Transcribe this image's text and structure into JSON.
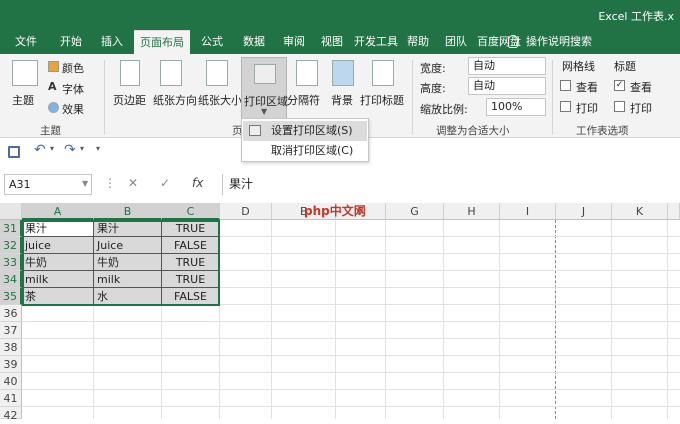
{
  "titlebar": {
    "title": "Excel 工作表.x"
  },
  "tabs": [
    "文件",
    "开始",
    "插入",
    "页面布局",
    "公式",
    "数据",
    "审阅",
    "视图",
    "开发工具",
    "帮助",
    "团队",
    "百度网盘"
  ],
  "active_tab": "页面布局",
  "tell_me": "操作说明搜索",
  "ribbon": {
    "themes": {
      "theme": "主题",
      "colors": "颜色",
      "fonts": "字体",
      "effects": "效果",
      "group": "主题"
    },
    "page_setup": {
      "margins": "页边距",
      "orientation": "纸张方向",
      "size": "纸张大小",
      "print_area": "打印区域",
      "breaks": "分隔符",
      "background": "背景",
      "print_titles": "打印标题",
      "group": "页"
    },
    "scale": {
      "width_label": "宽度:",
      "width_value": "自动",
      "height_label": "高度:",
      "height_value": "自动",
      "scale_label": "缩放比例:",
      "scale_value": "100%",
      "group": "调整为合适大小"
    },
    "sheet_options": {
      "gridlines": "网格线",
      "headings": "标题",
      "view1": "查看",
      "print1": "打印",
      "view2": "查看",
      "print2": "打印",
      "group": "工作表选项"
    }
  },
  "print_area_menu": {
    "set": "设置打印区域(S)",
    "clear": "取消打印区域(C)"
  },
  "formula_bar": {
    "name_box": "A31",
    "fx": "fx",
    "content": "果汁"
  },
  "watermark": "php中文网",
  "columns": [
    "A",
    "B",
    "C",
    "D",
    "E",
    "F",
    "G",
    "H",
    "I",
    "J",
    "K"
  ],
  "rows": [
    {
      "num": "31",
      "a": "果汁",
      "b": "果汁",
      "c": "TRUE"
    },
    {
      "num": "32",
      "a": "juice",
      "b": "Juice",
      "c": "FALSE"
    },
    {
      "num": "33",
      "a": "牛奶",
      "b": "牛奶",
      "c": "TRUE"
    },
    {
      "num": "34",
      "a": "milk",
      "b": "milk",
      "c": "TRUE"
    },
    {
      "num": "35",
      "a": "茶",
      "b": "水",
      "c": "FALSE"
    },
    {
      "num": "36",
      "a": "",
      "b": "",
      "c": ""
    },
    {
      "num": "37",
      "a": "",
      "b": "",
      "c": ""
    },
    {
      "num": "38",
      "a": "",
      "b": "",
      "c": ""
    },
    {
      "num": "39",
      "a": "",
      "b": "",
      "c": ""
    },
    {
      "num": "40",
      "a": "",
      "b": "",
      "c": ""
    },
    {
      "num": "41",
      "a": "",
      "b": "",
      "c": ""
    },
    {
      "num": "42",
      "a": "",
      "b": "",
      "c": ""
    }
  ],
  "colors": {
    "accent": "#217346",
    "selection_fill": "#d9d9d9"
  }
}
